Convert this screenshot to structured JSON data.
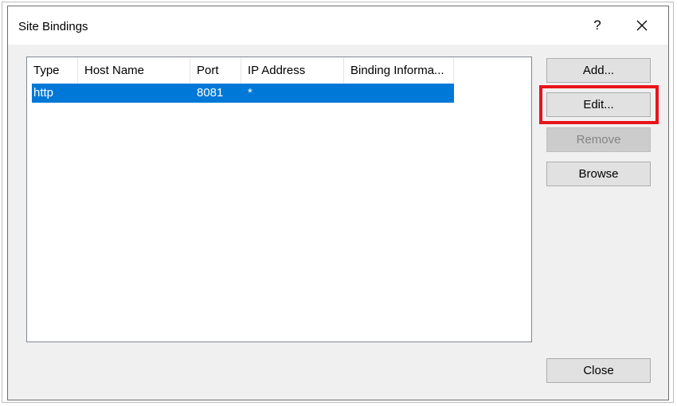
{
  "window": {
    "title": "Site Bindings",
    "help_label": "?"
  },
  "list": {
    "columns": [
      "Type",
      "Host Name",
      "Port",
      "IP Address",
      "Binding Informa..."
    ],
    "rows": [
      {
        "type": "http",
        "host_name": "",
        "port": "8081",
        "ip_address": "*",
        "binding_info": ""
      }
    ],
    "selected_row": 0
  },
  "buttons": {
    "add": "Add...",
    "edit": "Edit...",
    "remove": "Remove",
    "browse": "Browse",
    "close": "Close"
  },
  "annotation": {
    "highlight_color": "#e8141c",
    "highlighted_target": "edit"
  },
  "colors": {
    "selection": "#0078d7",
    "dialog_bg": "#f0f0f0"
  }
}
